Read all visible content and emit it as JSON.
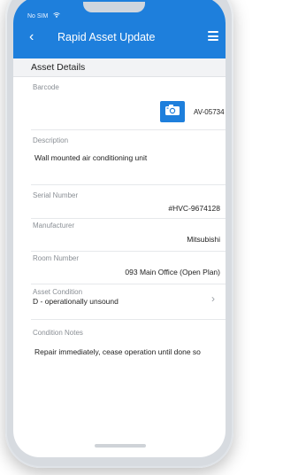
{
  "status": {
    "carrier": "No SIM",
    "wifi": "wifi-icon"
  },
  "header": {
    "title": "Rapid Asset Update",
    "back_icon": "chevron-left-icon",
    "menu_icon": "hamburger-menu-icon",
    "accent": "#1e7fdc"
  },
  "section": {
    "title": "Asset Details"
  },
  "fields": {
    "barcode": {
      "label": "Barcode",
      "value": "AV-05734",
      "icon": "camera-icon"
    },
    "description": {
      "label": "Description",
      "value": "Wall mounted air conditioning unit"
    },
    "serial": {
      "label": "Serial Number",
      "value": "#HVC-9674128"
    },
    "manufacturer": {
      "label": "Manufacturer",
      "value": "Mitsubishi"
    },
    "room": {
      "label": "Room Number",
      "value": "093 Main Office (Open Plan)"
    },
    "condition": {
      "label": "Asset Condition",
      "value": "D - operationally unsound",
      "icon": "chevron-right-icon"
    },
    "notes": {
      "label": "Condition Notes",
      "value": "Repair immediately, cease operation until done so"
    }
  }
}
